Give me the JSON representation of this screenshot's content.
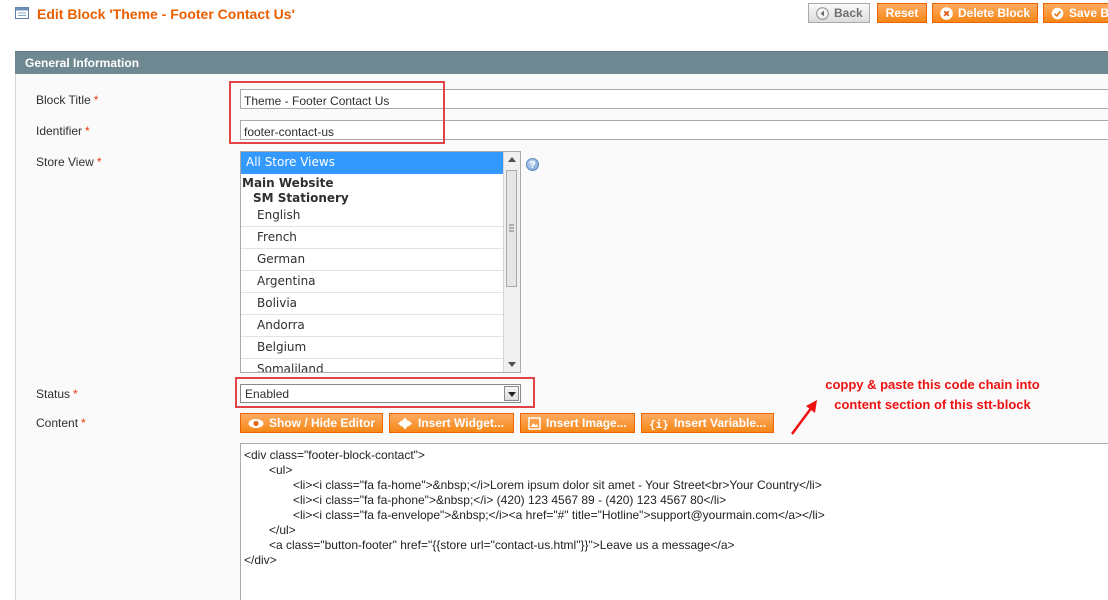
{
  "header": {
    "title": "Edit Block 'Theme - Footer Contact Us'",
    "buttons": {
      "back": "Back",
      "reset": "Reset",
      "delete": "Delete Block",
      "save": "Save Block"
    }
  },
  "section": {
    "title": "General Information"
  },
  "form": {
    "block_title": {
      "label": "Block Title",
      "required": "*",
      "value": "Theme - Footer Contact Us"
    },
    "identifier": {
      "label": "Identifier",
      "required": "*",
      "value": "footer-contact-us"
    },
    "store_view": {
      "label": "Store View",
      "required": "*",
      "options": {
        "all": "All Store Views",
        "website": "Main Website",
        "store": "SM Stationery",
        "views": [
          "English",
          "French",
          "German",
          "Argentina",
          "Bolivia",
          "Andorra",
          "Belgium",
          "Somaliland"
        ]
      }
    },
    "status": {
      "label": "Status",
      "required": "*",
      "value": "Enabled"
    },
    "content": {
      "label": "Content",
      "required": "*",
      "buttons": {
        "show_hide": "Show / Hide Editor",
        "widget": "Insert Widget...",
        "image": "Insert Image...",
        "variable": "Insert Variable..."
      },
      "lines": [
        "<div class=\"footer-block-contact\">",
        "<ul>",
        "<li><i class=\"fa fa-home\">&nbsp;</i>Lorem ipsum dolor sit amet - Your Street<br>Your Country</li>",
        "<li><i class=\"fa fa-phone\">&nbsp;</i> (420) 123 4567 89 - (420) 123 4567 80</li>",
        "<li><i class=\"fa fa-envelope\">&nbsp;</i><a href=\"#\" title=\"Hotline\">support@yourmain.com</a></li>",
        "</ul>",
        "<a class=\"button-footer\" href=\"{{store url=\"contact-us.html\"}}\">Leave us a message</a>",
        "</div>"
      ]
    }
  },
  "annotation": {
    "line1": "coppy & paste this code chain into",
    "line2": "content section of this stt-block"
  },
  "colors": {
    "title": "#eb5e00",
    "button": "#f68717",
    "section_header": "#6f8992",
    "highlight_box": "#e04444",
    "annotation": "#ee1111",
    "selected_option": "#3399ff"
  },
  "icons": {
    "title": "cms-block-icon",
    "back": "back-arrow-icon",
    "delete": "delete-x-icon",
    "save": "save-check-icon",
    "help": "help-icon",
    "show_hide": "eye-icon",
    "widget": "widget-icon",
    "image": "image-icon",
    "variable": "variable-icon",
    "annotation_arrow": "red-arrow-icon"
  }
}
